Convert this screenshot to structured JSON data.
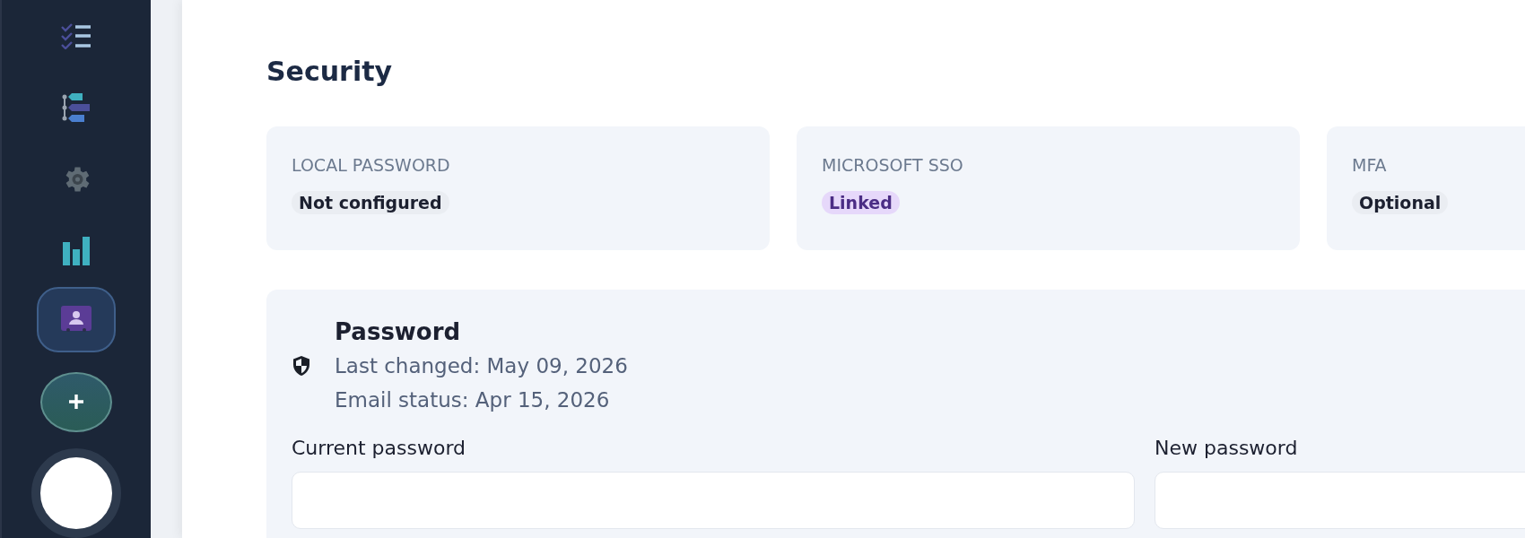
{
  "sidebar": {
    "items": [
      {
        "selected": false
      },
      {
        "selected": false
      },
      {
        "selected": false
      },
      {
        "selected": false
      },
      {
        "selected": true
      }
    ]
  },
  "page": {
    "title": "Security"
  },
  "cards": [
    {
      "label": "LOCAL PASSWORD",
      "badge": "Not configured",
      "kind": "neutral"
    },
    {
      "label": "MICROSOFT SSO",
      "badge": "Linked",
      "kind": "accent"
    },
    {
      "label": "MFA",
      "badge": "Optional",
      "kind": "neutral"
    }
  ],
  "password": {
    "title": "Password",
    "lines": [
      "Last changed: May 09, 2026",
      "Email status: Apr 15, 2026"
    ],
    "fields": [
      {
        "label": "Current password"
      },
      {
        "label": "New password"
      }
    ]
  }
}
